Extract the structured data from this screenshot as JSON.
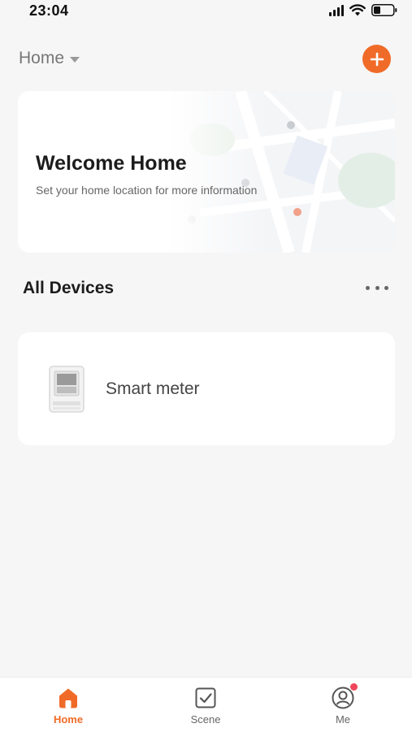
{
  "status_bar": {
    "time": "23:04",
    "icons": [
      "signal-icon",
      "wifi-icon",
      "battery-icon"
    ]
  },
  "header": {
    "home_label": "Home",
    "add_icon": "plus-icon"
  },
  "welcome_card": {
    "title": "Welcome Home",
    "subtitle": "Set your home location for more information"
  },
  "devices_section": {
    "title": "All Devices",
    "more_icon": "more-dots-icon"
  },
  "devices": [
    {
      "name": "Smart meter",
      "icon": "smart-meter-icon"
    }
  ],
  "tabs": [
    {
      "label": "Home",
      "icon": "home-icon",
      "active": true
    },
    {
      "label": "Scene",
      "icon": "scene-check-icon",
      "active": false
    },
    {
      "label": "Me",
      "icon": "profile-icon",
      "active": false,
      "notification": true
    }
  ],
  "colors": {
    "accent": "#f06b28",
    "background": "#f6f6f6",
    "notification": "#f0455a"
  }
}
